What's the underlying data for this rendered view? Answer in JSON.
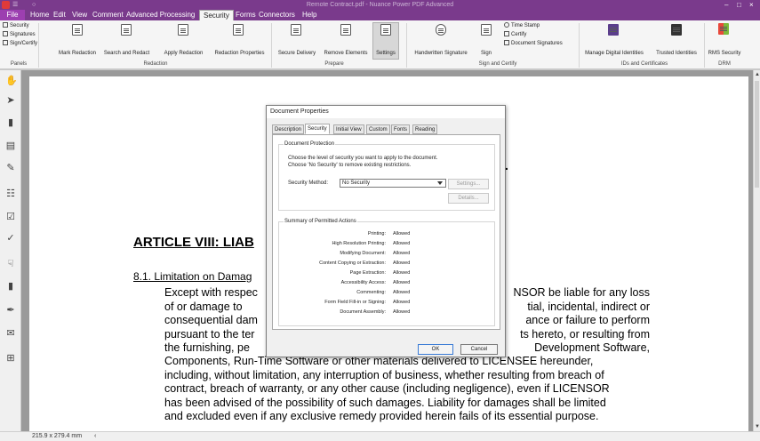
{
  "titlebar": {
    "title": "Remote Contract.pdf - Nuance Power PDF Advanced",
    "quick_access": [
      "☰",
      "○"
    ],
    "window_controls": [
      "–",
      "□",
      "×"
    ]
  },
  "tabs": [
    {
      "label": "File"
    },
    {
      "label": "Home"
    },
    {
      "label": "Edit"
    },
    {
      "label": "View"
    },
    {
      "label": "Comment"
    },
    {
      "label": "Advanced Processing"
    },
    {
      "label": "Security"
    },
    {
      "label": "Forms"
    },
    {
      "label": "Connectors"
    },
    {
      "label": "Help"
    }
  ],
  "ribbon": {
    "panels_group": {
      "items": [
        "Security",
        "Signatures",
        "Sign/Certify"
      ],
      "label": "Panels"
    },
    "redaction_group": {
      "items": [
        "Mark Redaction",
        "Search and Redact",
        "Apply Redaction",
        "Redaction Properties"
      ],
      "label": "Redaction"
    },
    "prepare_group": {
      "items": [
        "Secure Delivery",
        "Remove Elements",
        "Settings"
      ],
      "label": "Prepare"
    },
    "sign_group": {
      "items": [
        "Handwritten Signature",
        "Sign"
      ],
      "small_items": [
        "Time Stamp",
        "Certify",
        "Document Signatures"
      ],
      "label": "Sign and Certify"
    },
    "ids_group": {
      "items": [
        "Manage Digital Identities",
        "Trusted Identities"
      ],
      "label": "IDs and Certificates"
    },
    "drm_group": {
      "items": [
        "RMS Security"
      ],
      "label": "DRM"
    }
  },
  "document": {
    "dot": ".",
    "heading": "ARTICLE VIII: LIAB",
    "subheading": "8.1. Limitation on Damag",
    "paragraph_lines": [
      "Except with respec",
      "NSOR be liable for any loss",
      "of or damage to",
      "tial, incidental, indirect or",
      "consequential dam",
      "ance or failure to perform",
      "pursuant to the ter",
      "ts hereto, or resulting from",
      "the furnishing, pe",
      "Development Software,",
      "Components, Run-Time Software or other materials delivered to LICENSEE hereunder,",
      "including, without limitation, any interruption of business, whether resulting from breach of",
      "contract, breach of warranty, or any other cause (including negligence), even if LICENSOR",
      "has been advised of the possibility of such damages. Liability for damages shall be limited",
      "and excluded even if any exclusive remedy provided herein fails of its essential purpose."
    ]
  },
  "statusbar": {
    "page_size": "215.9 x 279.4 mm",
    "nav": "‹"
  },
  "dialog": {
    "title": "Document Properties",
    "tabs": [
      "Description",
      "Security",
      "Initial View",
      "Custom",
      "Fonts",
      "Reading"
    ],
    "protection_group": "Document Protection",
    "protection_text_1": "Choose the level of security you want to apply to the document.",
    "protection_text_2": "Choose 'No Security' to remove existing restrictions.",
    "method_label": "Security Method:",
    "method_value": "No Security",
    "settings_btn": "Settings...",
    "details_btn": "Details...",
    "summary_group": "Summary of Permitted Actions",
    "permissions": [
      {
        "label": "Printing:",
        "value": "Allowed"
      },
      {
        "label": "High Resolution Printing:",
        "value": "Allowed"
      },
      {
        "label": "Modifying Document:",
        "value": "Allowed"
      },
      {
        "label": "Content Copying or Extraction:",
        "value": "Allowed"
      },
      {
        "label": "Page Extraction:",
        "value": "Allowed"
      },
      {
        "label": "Accessibility Access:",
        "value": "Allowed"
      },
      {
        "label": "Commenting:",
        "value": "Allowed"
      },
      {
        "label": "Form Field Fill-in or Signing:",
        "value": "Allowed"
      },
      {
        "label": "Document Assembly:",
        "value": "Allowed"
      }
    ],
    "ok": "OK",
    "cancel": "Cancel"
  }
}
